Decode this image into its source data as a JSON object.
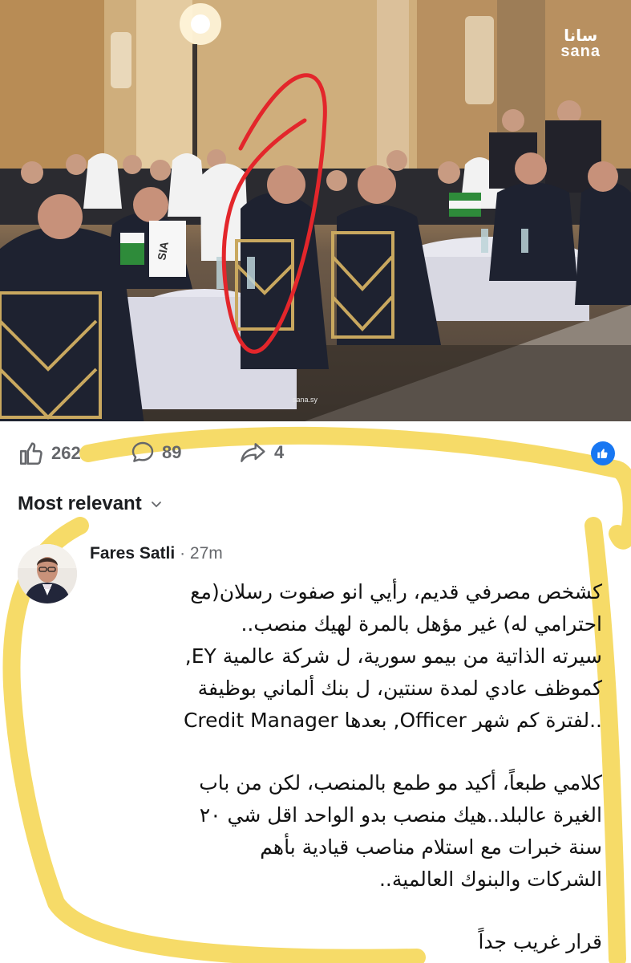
{
  "photo": {
    "watermark_arabic": "سانا",
    "watermark_latin": "sana",
    "credit": "sana.sy",
    "flag_text": "SIA"
  },
  "reactions": {
    "likes": "262",
    "comments": "89",
    "shares": "4",
    "like_icon": "thumbs-up-icon",
    "comment_icon": "speech-bubble-icon",
    "share_icon": "share-arrow-icon"
  },
  "sort": {
    "label": "Most relevant",
    "icon": "chevron-down-icon"
  },
  "comment": {
    "author": "Fares Satli",
    "separator": "·",
    "time": "27m",
    "paragraphs": [
      [
        "كشخص مصرفي قديم، رأيي انو صفوت رسلان(مع",
        "احترامي له) غير مؤهل بالمرة لهيك منصب..",
        "سيرته الذاتية من بيمو سورية، ل شركة عالمية EY,",
        "كموظف عادي لمدة سنتين، ل بنك ألماني بوظيفة",
        "Credit Manager بعدها ,Officer لفترة كم شهر.."
      ],
      [
        "كلامي طبعاً، أكيد مو طمع بالمنصب، لكن من باب",
        "الغيرة عالبلد..هيك منصب بدو الواحد اقل شي ٢٠",
        "سنة خبرات مع استلام مناصب قيادية بأهم",
        "الشركات والبنوك العالمية.."
      ],
      [
        "قرار غريب جداً"
      ]
    ]
  },
  "colors": {
    "facebook_blue": "#1877f2",
    "highlighter_yellow": "#f4d54e",
    "circle_red": "#e3262b",
    "secondary_text": "#65676b"
  }
}
